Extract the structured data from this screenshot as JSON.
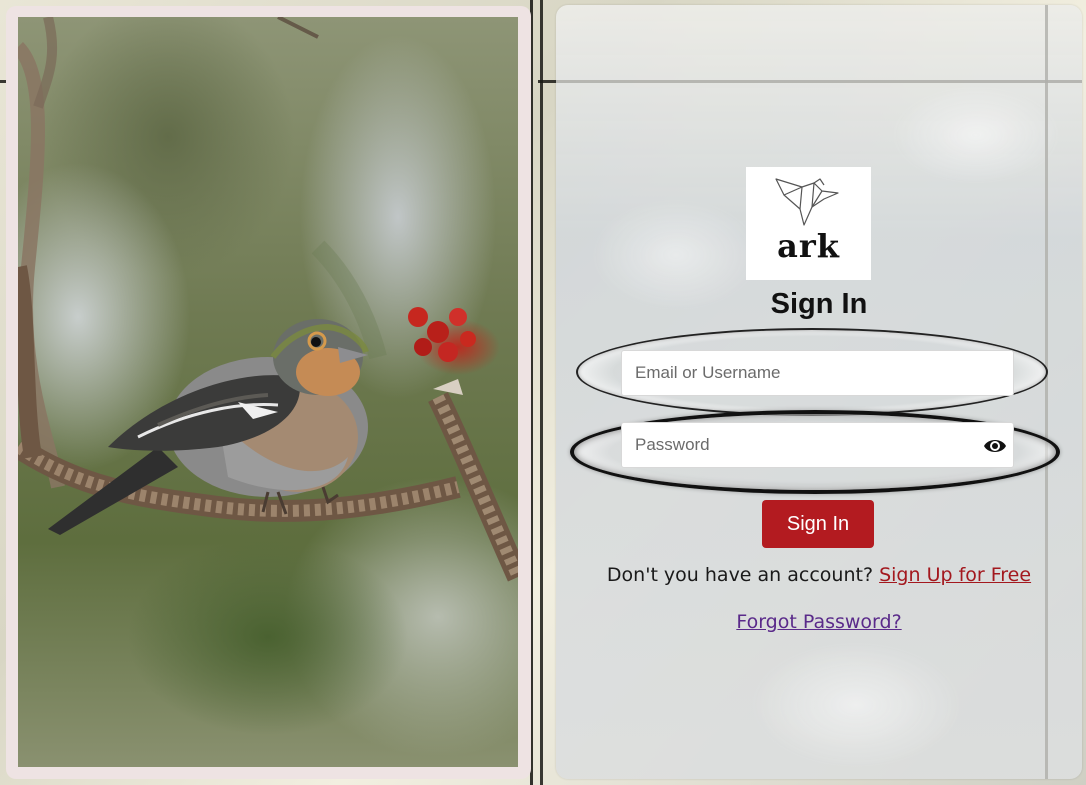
{
  "brand": {
    "logo_text": "ark",
    "logo_icon": "origami-bird-icon"
  },
  "form": {
    "title": "Sign In",
    "email_placeholder": "Email or Username",
    "password_placeholder": "Password",
    "password_toggle_icon": "eye-icon",
    "submit_label": "Sign In",
    "signup_prompt": "Don't you have an account?",
    "signup_link": "Sign Up for Free",
    "forgot_link": "Forgot Password?"
  },
  "colors": {
    "primary": "#b31b20",
    "link": "#a3181e",
    "visited_link": "#5a2a8a"
  },
  "photo": {
    "subject": "bird-on-branch-image"
  }
}
